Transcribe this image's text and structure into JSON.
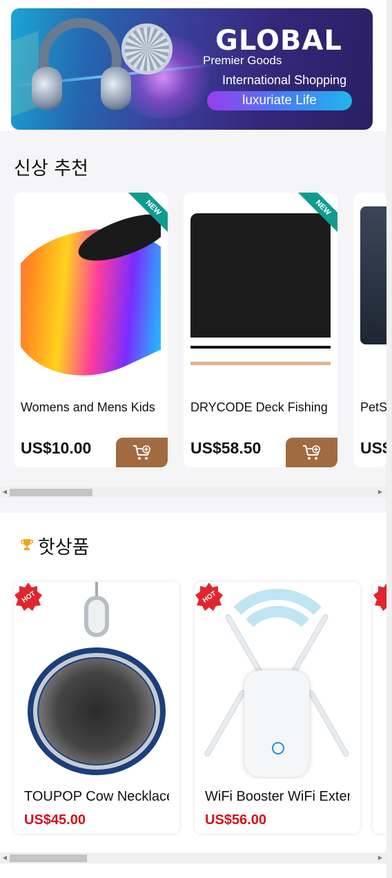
{
  "banner": {
    "brand": "GLOBAL",
    "line1": "Premier Goods",
    "line2": "International Shopping",
    "pill": "luxuriate Life"
  },
  "new_section": {
    "title": "신상 추천",
    "ribbon": "NEW",
    "products": [
      {
        "name": "Womens and Mens Kids",
        "price": "US$10.00"
      },
      {
        "name": "DRYCODE Deck Fishing",
        "price": "US$58.50"
      },
      {
        "name": "PetS",
        "price": "US$"
      }
    ]
  },
  "hot_section": {
    "title": "핫상품",
    "badge": "HOT",
    "products": [
      {
        "name": "TOUPOP Cow Necklace",
        "price": "US$45.00"
      },
      {
        "name": "WiFi Booster WiFi Extender",
        "price": "US$56.00"
      }
    ]
  },
  "colors": {
    "cart_button": "#a26a3f",
    "new_ribbon": "#0f9c8e",
    "hot_badge": "#e0262c",
    "hot_price": "#d0101b"
  },
  "icons": [
    "cart-add-icon",
    "trophy-icon",
    "arrow-left-icon",
    "arrow-right-icon"
  ]
}
